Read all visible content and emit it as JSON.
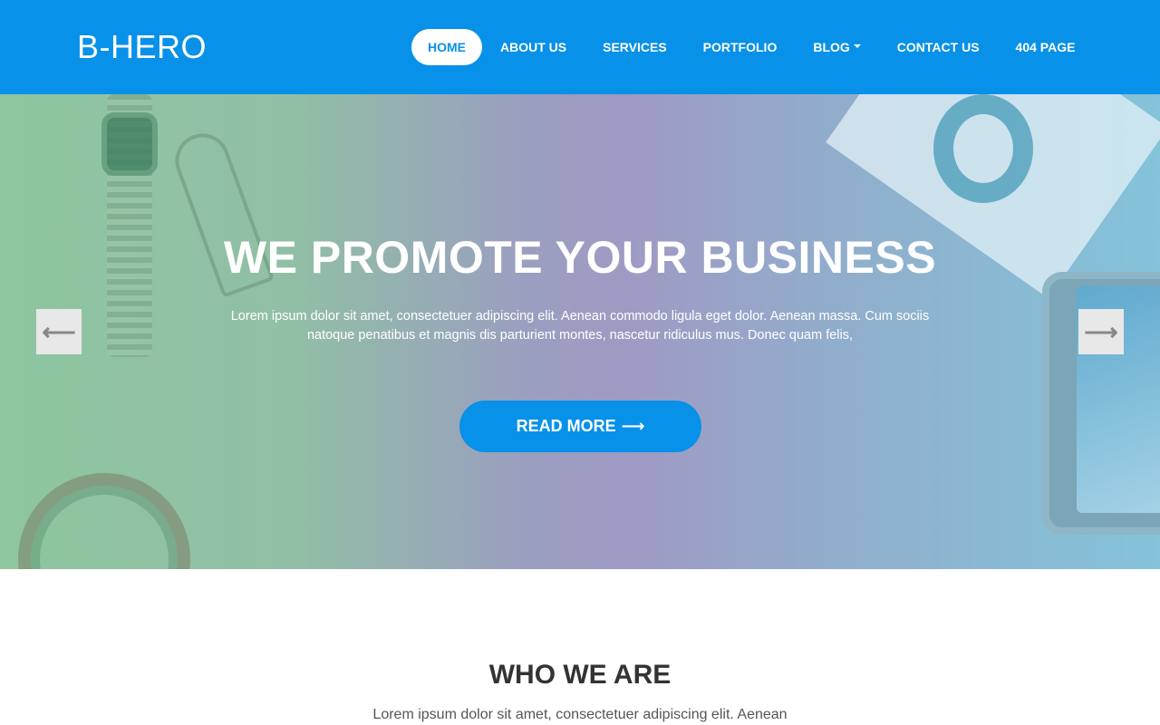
{
  "header": {
    "brand": "B-HERO",
    "nav": [
      {
        "label": "HOME",
        "active": true
      },
      {
        "label": "ABOUT US"
      },
      {
        "label": "SERVICES"
      },
      {
        "label": "PORTFOLIO"
      },
      {
        "label": "BLOG",
        "has_dropdown": true
      },
      {
        "label": "CONTACT US"
      },
      {
        "label": "404 PAGE"
      }
    ]
  },
  "hero": {
    "title": "WE PROMOTE YOUR BUSINESS",
    "text_line1": "Lorem ipsum dolor sit amet, consectetuer adipiscing elit. Aenean commodo ligula eget dolor. Aenean massa. Cum sociis",
    "text_line2": "natoque penatibus et magnis dis parturient montes, nascetur ridiculus mus. Donec quam felis,",
    "button_label": "READ MORE",
    "prev_icon": "left-arrow-icon",
    "next_icon": "right-arrow-icon"
  },
  "who_we_are": {
    "title": "WHO WE ARE",
    "text": "Lorem ipsum dolor sit amet, consectetuer adipiscing elit. Aenean"
  },
  "colors": {
    "primary": "#0891e8",
    "white": "#ffffff",
    "heading": "#333333",
    "body_text": "#555555",
    "arrow_bg": "#e8e8e8"
  }
}
